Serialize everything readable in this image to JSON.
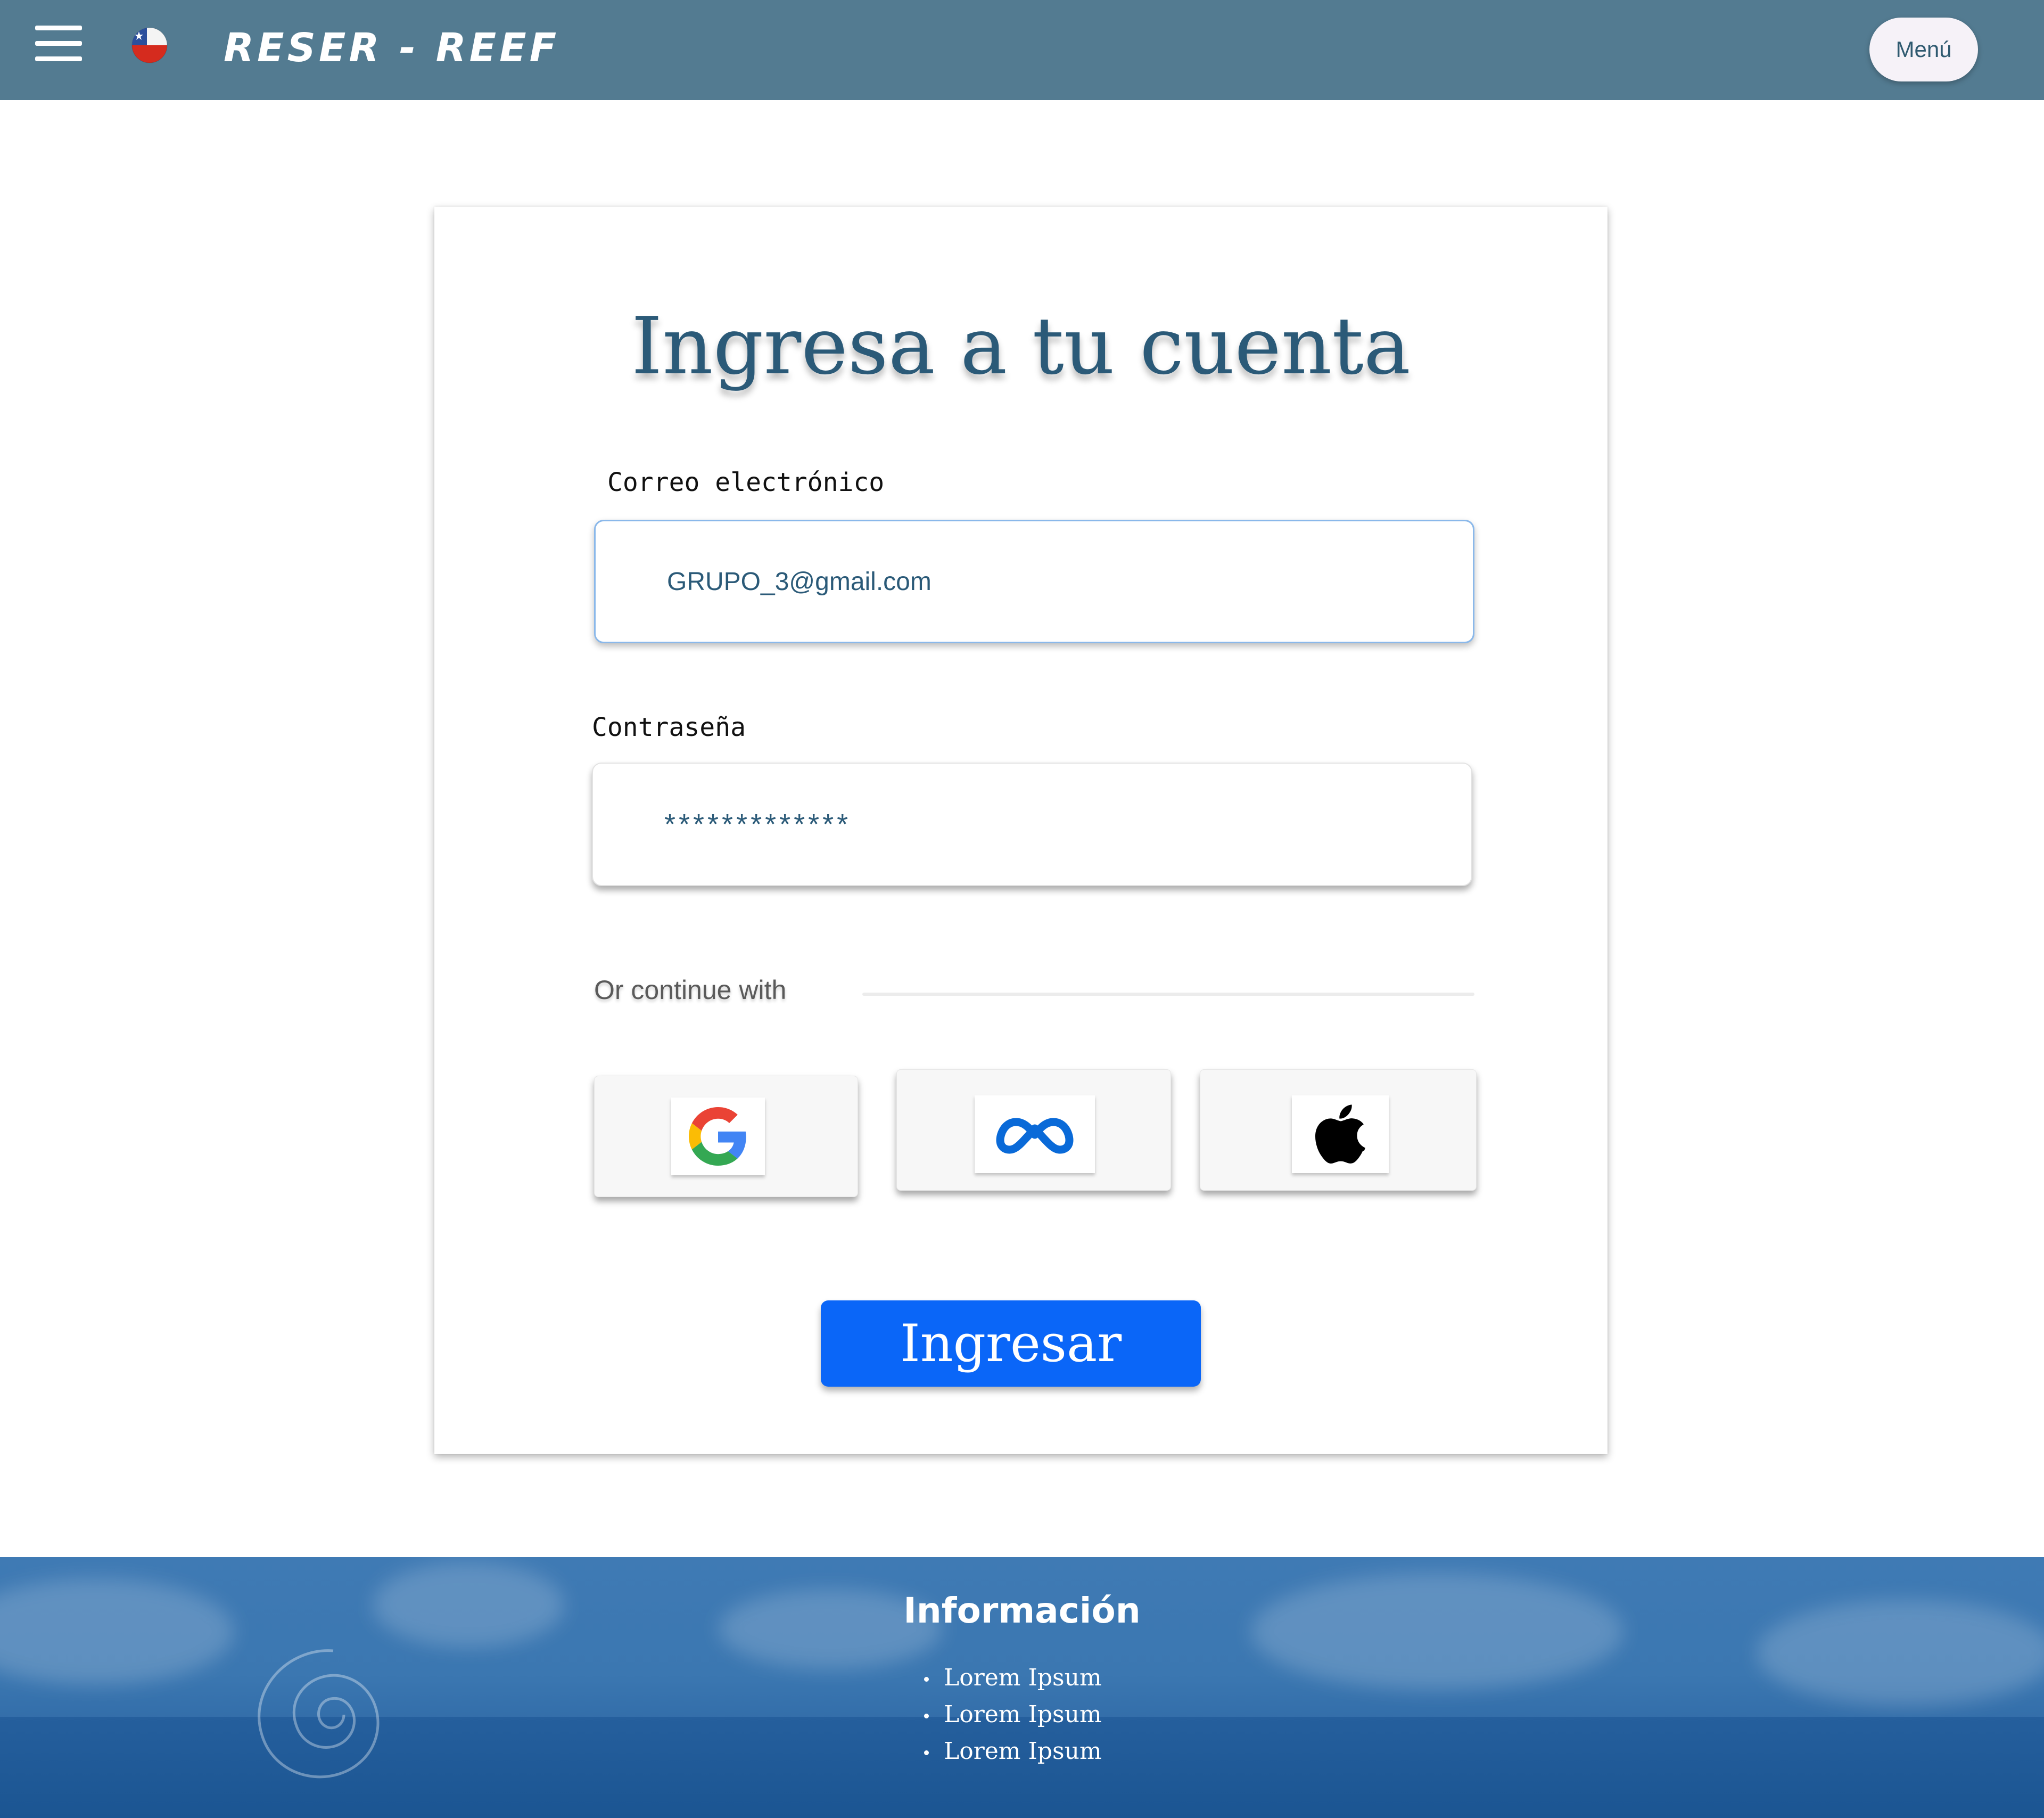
{
  "header": {
    "brand": "RESER - REEF",
    "menu_label": "Menú"
  },
  "login": {
    "title": "Ingresa a tu  cuenta",
    "email_label": "Correo electrónico",
    "email_value": "GRUPO_3@gmail.com",
    "password_label": "Contraseña",
    "password_value": "*************",
    "divider_text": "Or continue with",
    "social": [
      {
        "name": "google",
        "icon": "google-icon"
      },
      {
        "name": "meta",
        "icon": "meta-icon"
      },
      {
        "name": "apple",
        "icon": "apple-icon"
      }
    ],
    "submit_label": "Ingresar"
  },
  "footer": {
    "title": "Información",
    "links": [
      "Lorem Ipsum",
      "Lorem Ipsum",
      "Lorem Ipsum"
    ]
  },
  "colors": {
    "header_bg": "#537b91",
    "title_text": "#2b5a78",
    "primary_button": "#0a66f8",
    "footer_bg": "#3b77b1"
  }
}
